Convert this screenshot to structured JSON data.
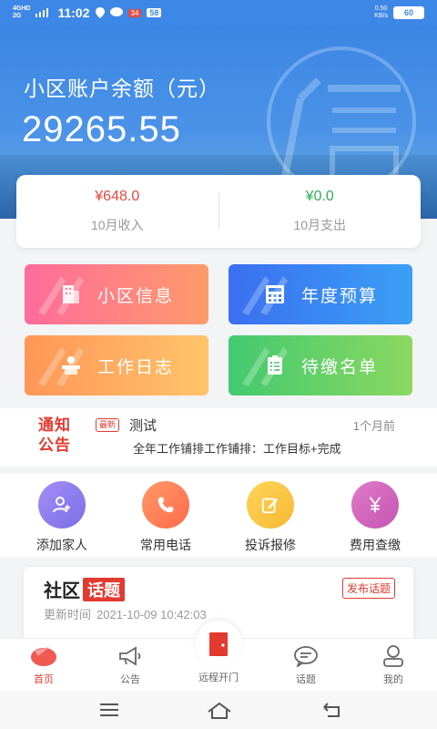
{
  "status_bar": {
    "network_top": "4GHD",
    "network_bottom": "2G",
    "time": "11:02",
    "badge_red": "34",
    "badge_white": "58",
    "speed_top": "0.50",
    "speed_bottom": "KB/s",
    "battery": "60"
  },
  "header": {
    "title": "小区账户余额（元）",
    "balance": "29265.55"
  },
  "summary": {
    "income_value": "¥648.0",
    "income_label": "10月收入",
    "expense_value": "¥0.0",
    "expense_label": "10月支出",
    "income_color": "#e04a3a",
    "expense_color": "#2fae52"
  },
  "tiles": {
    "community_info": "小区信息",
    "annual_budget": "年度预算",
    "work_log": "工作日志",
    "payment_list": "待缴名单"
  },
  "notice": {
    "logo_line1": "通知",
    "logo_line2": "公告",
    "new_badge": "最新",
    "title": "测试",
    "time": "1个月前",
    "body": "全年工作铺排工作铺排：工作目标+完成"
  },
  "actions": {
    "add_family": "添加家人",
    "phone": "常用电话",
    "complaint": "投诉报修",
    "fees": "费用查缴"
  },
  "topic": {
    "title_part1": "社区",
    "title_part2": "话题",
    "post_button": "发布话题",
    "updated_label": "更新时间",
    "updated_time": "2021-10-09 10:42:03"
  },
  "tabbar": {
    "home": "首页",
    "announcements": "公告",
    "remote_door": "远程开门",
    "topics": "话题",
    "mine": "我的"
  },
  "colors": {
    "accent": "#e33a2f",
    "header_blue": "#3d87e6"
  }
}
